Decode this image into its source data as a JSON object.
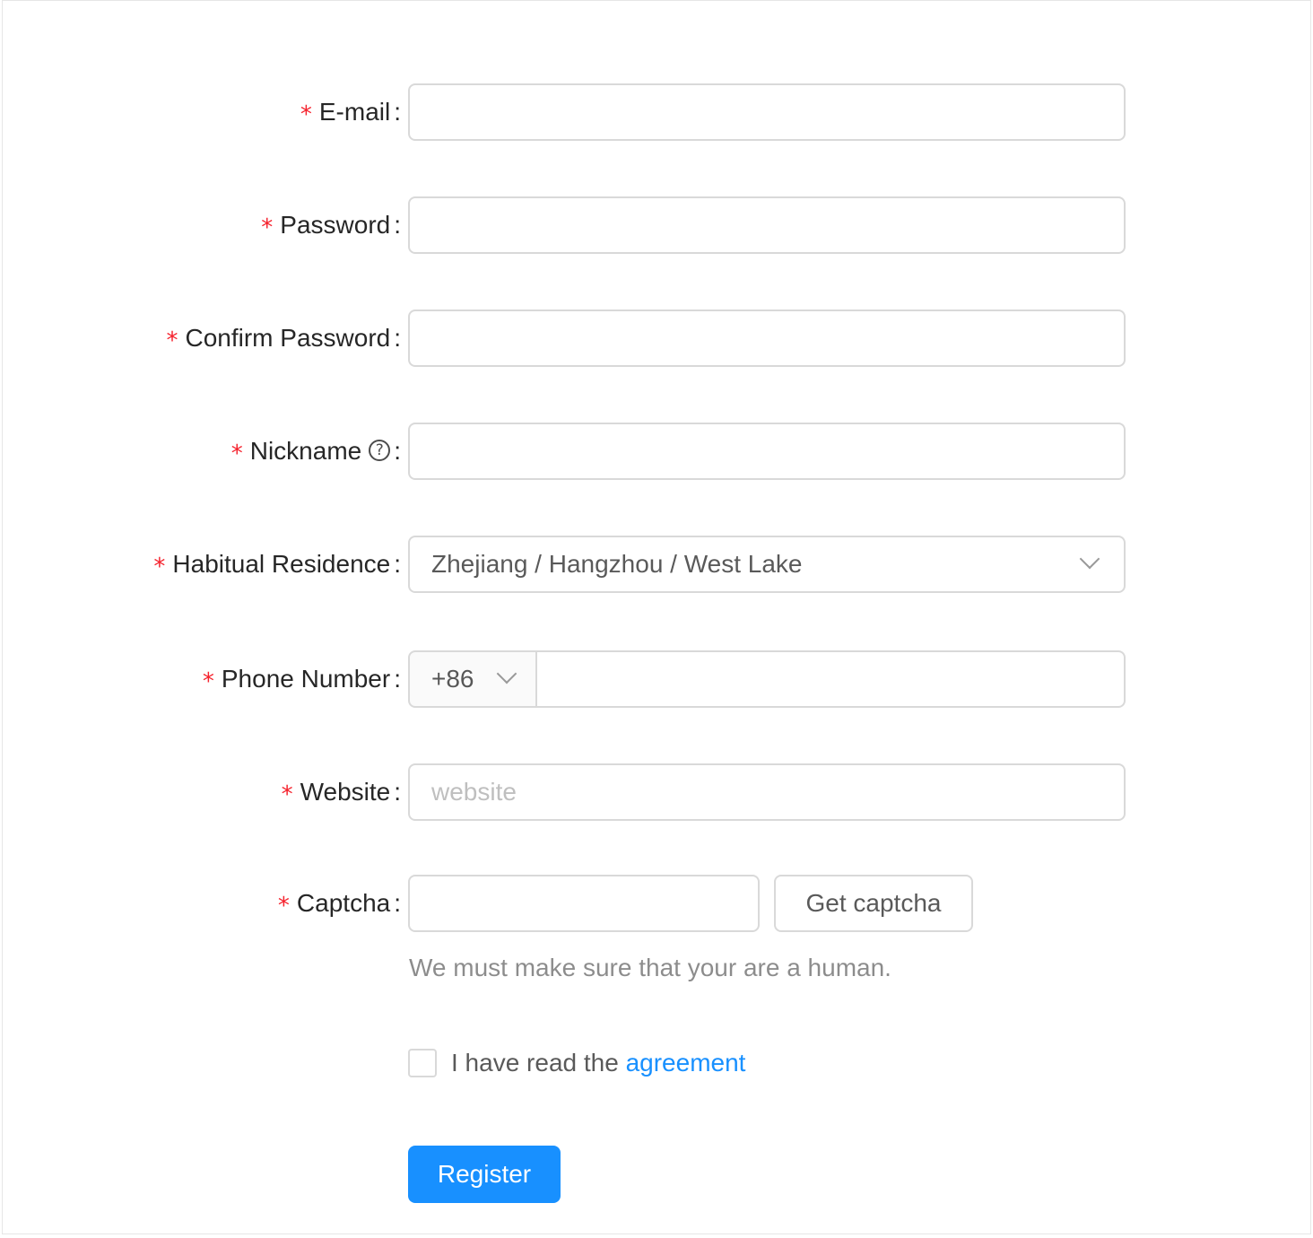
{
  "form": {
    "email": {
      "label": "E-mail",
      "value": ""
    },
    "password": {
      "label": "Password",
      "value": ""
    },
    "confirm_password": {
      "label": "Confirm Password",
      "value": ""
    },
    "nickname": {
      "label": "Nickname",
      "value": "",
      "help_icon": "question-circle-icon",
      "help_glyph": "?"
    },
    "residence": {
      "label": "Habitual Residence",
      "value": "Zhejiang / Hangzhou / West Lake",
      "icon": "chevron-down-icon"
    },
    "phone": {
      "label": "Phone Number",
      "prefix": "+86",
      "value": "",
      "icon": "chevron-down-icon"
    },
    "website": {
      "label": "Website",
      "value": "",
      "placeholder": "website"
    },
    "captcha": {
      "label": "Captcha",
      "value": "",
      "button_label": "Get captcha",
      "extra": "We must make sure that your are a human."
    },
    "agreement": {
      "checked": false,
      "text": "I have read the ",
      "link_text": "agreement"
    },
    "submit_label": "Register",
    "required_mark": "*",
    "colon": ":"
  },
  "colors": {
    "primary": "#1890ff",
    "required": "#f5222d",
    "border": "#d9d9d9"
  }
}
